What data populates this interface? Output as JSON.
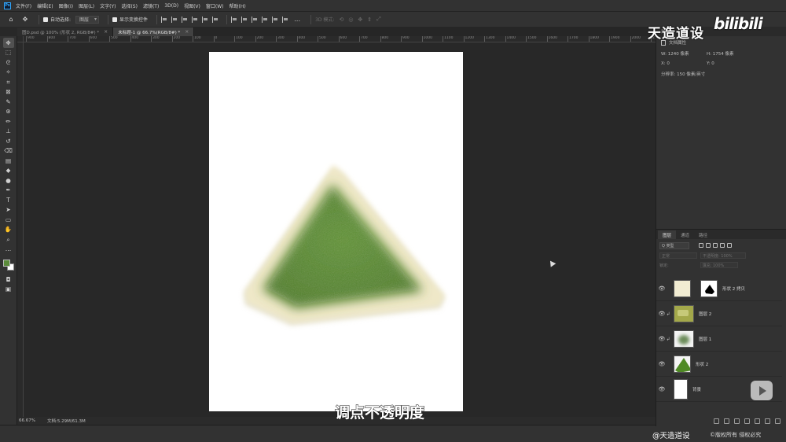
{
  "menubar": {
    "app_icon": "Ps",
    "items": [
      "文件(F)",
      "编辑(E)",
      "图像(I)",
      "图层(L)",
      "文字(Y)",
      "选择(S)",
      "滤镜(T)",
      "3D(D)",
      "视图(V)",
      "窗口(W)",
      "帮助(H)"
    ]
  },
  "options": {
    "auto_select_label": "自动选择:",
    "auto_select_value": "图层",
    "show_transform_label": "显示变换控件",
    "mode_3d_label": "3D 模式:"
  },
  "tabs": [
    {
      "label": "图D.psd @ 100% (形状 2, RGB/8#) *"
    },
    {
      "label": "未标题-1 @ 66.7%(RGB/8#) *"
    }
  ],
  "rulers": {
    "top_ticks": [
      "900",
      "800",
      "700",
      "600",
      "500",
      "400",
      "300",
      "200",
      "100",
      "0",
      "100",
      "200",
      "300",
      "400",
      "500",
      "600",
      "700",
      "800",
      "900",
      "1000",
      "1100",
      "1200",
      "1300",
      "1400",
      "1500",
      "1600",
      "1700",
      "1800",
      "1900",
      "2000",
      "2100"
    ]
  },
  "toolbar": {
    "tools": [
      "move-icon",
      "marquee-icon",
      "lasso-icon",
      "magic-wand-icon",
      "crop-icon",
      "frame-icon",
      "eyedropper-icon",
      "healing-icon",
      "brush-icon",
      "stamp-icon",
      "history-brush-icon",
      "eraser-icon",
      "gradient-icon",
      "blur-icon",
      "dodge-icon",
      "pen-icon",
      "type-icon",
      "path-select-icon",
      "rectangle-icon",
      "hand-icon",
      "zoom-icon",
      "more-icon"
    ],
    "tool_glyphs": [
      "✥",
      "⬚",
      "ᘓ",
      "✧",
      "⌗",
      "⊠",
      "✎",
      "⊛",
      "✏",
      "⊥",
      "↺",
      "⌫",
      "▤",
      "◆",
      "●",
      "✒",
      "T",
      "➤",
      "▭",
      "✋",
      "⌕",
      "…"
    ],
    "foreground_color": "#5a8a3a",
    "background_color": "#ffffff"
  },
  "status": {
    "zoom": "66.67%",
    "doc_info": "文档:5.29M/61.3M"
  },
  "properties": {
    "tab": "属性",
    "title": "文档属性",
    "w": "W:  1240 像素",
    "h": "H:  1754 像素",
    "x": "X:  0",
    "y": "Y:  0",
    "resolution": "分辨率: 150 像素/英寸"
  },
  "layers": {
    "tabs": [
      "图层",
      "通道",
      "路径"
    ],
    "filter_label": "Q 类型",
    "blend_mode": "正常",
    "opacity_label": "不透明度: 100%",
    "lock_label": "锁定:",
    "fill_label": "填充: 100%",
    "items": [
      {
        "name": "形状 2 拷贝",
        "thumb": "cream",
        "mask": true
      },
      {
        "name": "图层 2",
        "thumb": "texture",
        "clipped": true
      },
      {
        "name": "图层 1",
        "thumb": "blur-green",
        "clipped": true
      },
      {
        "name": "形状 2",
        "thumb": "green-triangle"
      },
      {
        "name": "背景",
        "thumb": "white"
      }
    ]
  },
  "colors": {
    "triangle_outer": "#efe8c8",
    "triangle_inner": "#4f7d2a",
    "accent": "#31a8ff"
  },
  "overlays": {
    "brand": "天造道设",
    "logo": "bilibili",
    "subtitle": "调点不透明度",
    "credit_handle": "@天造道设",
    "credit_rights": "©版权所有 侵权必究"
  }
}
